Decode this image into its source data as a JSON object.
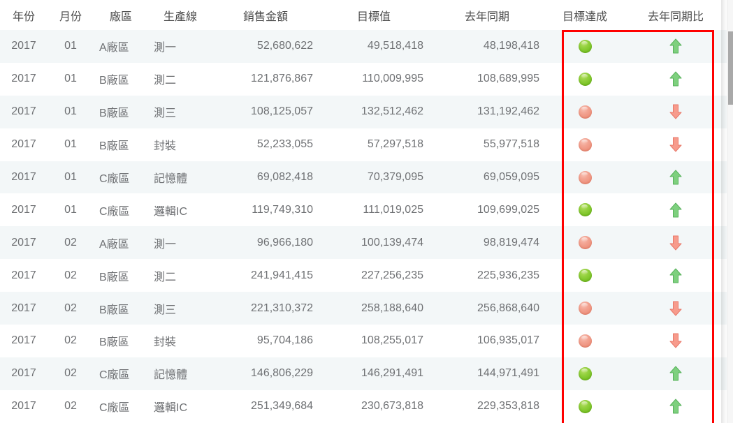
{
  "table": {
    "columns": [
      {
        "key": "year",
        "label": "年份"
      },
      {
        "key": "month",
        "label": "月份"
      },
      {
        "key": "plant",
        "label": "廠區"
      },
      {
        "key": "line",
        "label": "生產線"
      },
      {
        "key": "sales",
        "label": "銷售金額"
      },
      {
        "key": "target",
        "label": "目標值"
      },
      {
        "key": "lastyr",
        "label": "去年同期"
      },
      {
        "key": "ach",
        "label": "目標達成"
      },
      {
        "key": "yoy",
        "label": "去年同期比"
      }
    ],
    "rows": [
      {
        "year": "2017",
        "month": "01",
        "plant": "A廠區",
        "line": "測一",
        "sales": "52,680,622",
        "target": "49,518,418",
        "lastyr": "48,198,418",
        "ach": "green",
        "yoy": "up"
      },
      {
        "year": "2017",
        "month": "01",
        "plant": "B廠區",
        "line": "測二",
        "sales": "121,876,867",
        "target": "110,009,995",
        "lastyr": "108,689,995",
        "ach": "green",
        "yoy": "up"
      },
      {
        "year": "2017",
        "month": "01",
        "plant": "B廠區",
        "line": "測三",
        "sales": "108,125,057",
        "target": "132,512,462",
        "lastyr": "131,192,462",
        "ach": "red",
        "yoy": "down"
      },
      {
        "year": "2017",
        "month": "01",
        "plant": "B廠區",
        "line": "封裝",
        "sales": "52,233,055",
        "target": "57,297,518",
        "lastyr": "55,977,518",
        "ach": "red",
        "yoy": "down"
      },
      {
        "year": "2017",
        "month": "01",
        "plant": "C廠區",
        "line": "記憶體",
        "sales": "69,082,418",
        "target": "70,379,095",
        "lastyr": "69,059,095",
        "ach": "red",
        "yoy": "up"
      },
      {
        "year": "2017",
        "month": "01",
        "plant": "C廠區",
        "line": "邏輯IC",
        "sales": "119,749,310",
        "target": "111,019,025",
        "lastyr": "109,699,025",
        "ach": "green",
        "yoy": "up"
      },
      {
        "year": "2017",
        "month": "02",
        "plant": "A廠區",
        "line": "測一",
        "sales": "96,966,180",
        "target": "100,139,474",
        "lastyr": "98,819,474",
        "ach": "red",
        "yoy": "down"
      },
      {
        "year": "2017",
        "month": "02",
        "plant": "B廠區",
        "line": "測二",
        "sales": "241,941,415",
        "target": "227,256,235",
        "lastyr": "225,936,235",
        "ach": "green",
        "yoy": "up"
      },
      {
        "year": "2017",
        "month": "02",
        "plant": "B廠區",
        "line": "測三",
        "sales": "221,310,372",
        "target": "258,188,640",
        "lastyr": "256,868,640",
        "ach": "red",
        "yoy": "down"
      },
      {
        "year": "2017",
        "month": "02",
        "plant": "B廠區",
        "line": "封裝",
        "sales": "95,704,186",
        "target": "108,255,017",
        "lastyr": "106,935,017",
        "ach": "red",
        "yoy": "down"
      },
      {
        "year": "2017",
        "month": "02",
        "plant": "C廠區",
        "line": "記憶體",
        "sales": "146,806,229",
        "target": "146,291,491",
        "lastyr": "144,971,491",
        "ach": "green",
        "yoy": "up"
      },
      {
        "year": "2017",
        "month": "02",
        "plant": "C廠區",
        "line": "邏輯IC",
        "sales": "251,349,684",
        "target": "230,673,818",
        "lastyr": "229,353,818",
        "ach": "green",
        "yoy": "up"
      }
    ]
  },
  "indicators": {
    "green_dot_color": "#8fcc36",
    "red_dot_color": "#ef9483",
    "up_arrow_color": "#7ed07e",
    "down_arrow_color": "#f79b8c",
    "up_arrow_name": "arrow-up-icon",
    "down_arrow_name": "arrow-down-icon"
  },
  "annotation": {
    "highlight_color": "#ff0000",
    "highlight_label": "目標達成 / 去年同期比 欄位標示"
  },
  "scrollbar": {
    "orientation": "vertical",
    "thumb_color": "#a9a9a9",
    "track_color": "#f6f6f6"
  }
}
